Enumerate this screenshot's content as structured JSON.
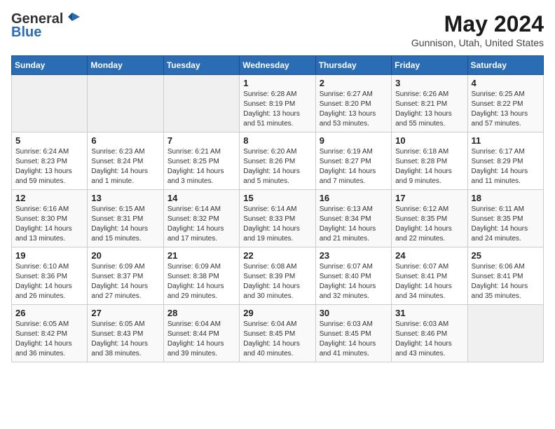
{
  "header": {
    "logo_general": "General",
    "logo_blue": "Blue",
    "title": "May 2024",
    "location": "Gunnison, Utah, United States"
  },
  "weekdays": [
    "Sunday",
    "Monday",
    "Tuesday",
    "Wednesday",
    "Thursday",
    "Friday",
    "Saturday"
  ],
  "weeks": [
    [
      {
        "day": "",
        "info": ""
      },
      {
        "day": "",
        "info": ""
      },
      {
        "day": "",
        "info": ""
      },
      {
        "day": "1",
        "info": "Sunrise: 6:28 AM\nSunset: 8:19 PM\nDaylight: 13 hours\nand 51 minutes."
      },
      {
        "day": "2",
        "info": "Sunrise: 6:27 AM\nSunset: 8:20 PM\nDaylight: 13 hours\nand 53 minutes."
      },
      {
        "day": "3",
        "info": "Sunrise: 6:26 AM\nSunset: 8:21 PM\nDaylight: 13 hours\nand 55 minutes."
      },
      {
        "day": "4",
        "info": "Sunrise: 6:25 AM\nSunset: 8:22 PM\nDaylight: 13 hours\nand 57 minutes."
      }
    ],
    [
      {
        "day": "5",
        "info": "Sunrise: 6:24 AM\nSunset: 8:23 PM\nDaylight: 13 hours\nand 59 minutes."
      },
      {
        "day": "6",
        "info": "Sunrise: 6:23 AM\nSunset: 8:24 PM\nDaylight: 14 hours\nand 1 minute."
      },
      {
        "day": "7",
        "info": "Sunrise: 6:21 AM\nSunset: 8:25 PM\nDaylight: 14 hours\nand 3 minutes."
      },
      {
        "day": "8",
        "info": "Sunrise: 6:20 AM\nSunset: 8:26 PM\nDaylight: 14 hours\nand 5 minutes."
      },
      {
        "day": "9",
        "info": "Sunrise: 6:19 AM\nSunset: 8:27 PM\nDaylight: 14 hours\nand 7 minutes."
      },
      {
        "day": "10",
        "info": "Sunrise: 6:18 AM\nSunset: 8:28 PM\nDaylight: 14 hours\nand 9 minutes."
      },
      {
        "day": "11",
        "info": "Sunrise: 6:17 AM\nSunset: 8:29 PM\nDaylight: 14 hours\nand 11 minutes."
      }
    ],
    [
      {
        "day": "12",
        "info": "Sunrise: 6:16 AM\nSunset: 8:30 PM\nDaylight: 14 hours\nand 13 minutes."
      },
      {
        "day": "13",
        "info": "Sunrise: 6:15 AM\nSunset: 8:31 PM\nDaylight: 14 hours\nand 15 minutes."
      },
      {
        "day": "14",
        "info": "Sunrise: 6:14 AM\nSunset: 8:32 PM\nDaylight: 14 hours\nand 17 minutes."
      },
      {
        "day": "15",
        "info": "Sunrise: 6:14 AM\nSunset: 8:33 PM\nDaylight: 14 hours\nand 19 minutes."
      },
      {
        "day": "16",
        "info": "Sunrise: 6:13 AM\nSunset: 8:34 PM\nDaylight: 14 hours\nand 21 minutes."
      },
      {
        "day": "17",
        "info": "Sunrise: 6:12 AM\nSunset: 8:35 PM\nDaylight: 14 hours\nand 22 minutes."
      },
      {
        "day": "18",
        "info": "Sunrise: 6:11 AM\nSunset: 8:35 PM\nDaylight: 14 hours\nand 24 minutes."
      }
    ],
    [
      {
        "day": "19",
        "info": "Sunrise: 6:10 AM\nSunset: 8:36 PM\nDaylight: 14 hours\nand 26 minutes."
      },
      {
        "day": "20",
        "info": "Sunrise: 6:09 AM\nSunset: 8:37 PM\nDaylight: 14 hours\nand 27 minutes."
      },
      {
        "day": "21",
        "info": "Sunrise: 6:09 AM\nSunset: 8:38 PM\nDaylight: 14 hours\nand 29 minutes."
      },
      {
        "day": "22",
        "info": "Sunrise: 6:08 AM\nSunset: 8:39 PM\nDaylight: 14 hours\nand 30 minutes."
      },
      {
        "day": "23",
        "info": "Sunrise: 6:07 AM\nSunset: 8:40 PM\nDaylight: 14 hours\nand 32 minutes."
      },
      {
        "day": "24",
        "info": "Sunrise: 6:07 AM\nSunset: 8:41 PM\nDaylight: 14 hours\nand 34 minutes."
      },
      {
        "day": "25",
        "info": "Sunrise: 6:06 AM\nSunset: 8:41 PM\nDaylight: 14 hours\nand 35 minutes."
      }
    ],
    [
      {
        "day": "26",
        "info": "Sunrise: 6:05 AM\nSunset: 8:42 PM\nDaylight: 14 hours\nand 36 minutes."
      },
      {
        "day": "27",
        "info": "Sunrise: 6:05 AM\nSunset: 8:43 PM\nDaylight: 14 hours\nand 38 minutes."
      },
      {
        "day": "28",
        "info": "Sunrise: 6:04 AM\nSunset: 8:44 PM\nDaylight: 14 hours\nand 39 minutes."
      },
      {
        "day": "29",
        "info": "Sunrise: 6:04 AM\nSunset: 8:45 PM\nDaylight: 14 hours\nand 40 minutes."
      },
      {
        "day": "30",
        "info": "Sunrise: 6:03 AM\nSunset: 8:45 PM\nDaylight: 14 hours\nand 41 minutes."
      },
      {
        "day": "31",
        "info": "Sunrise: 6:03 AM\nSunset: 8:46 PM\nDaylight: 14 hours\nand 43 minutes."
      },
      {
        "day": "",
        "info": ""
      }
    ]
  ]
}
